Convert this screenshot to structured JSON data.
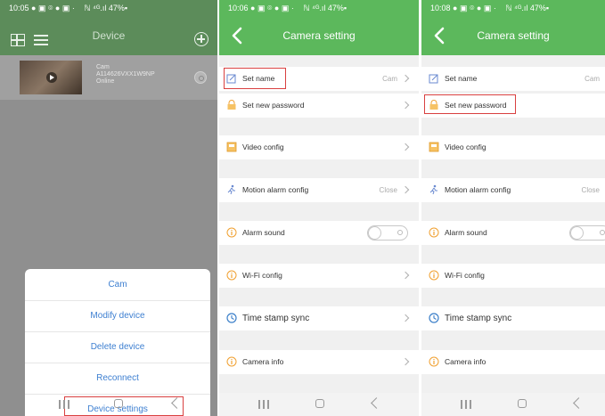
{
  "status_bar": [
    {
      "time": "10:05",
      "indicators": "● ▣ ⌾ ● ▣ ·",
      "right": "ℕ ⁴ᴳ.ıl 47%▪"
    },
    {
      "time": "10:06",
      "indicators": "● ▣ ⌾ ● ▣ ·",
      "right": "ℕ ⁴ᴳ.ıl 47%▪"
    },
    {
      "time": "10:08",
      "indicators": "● ▣ ⌾ ● ▣ ·",
      "right": "ℕ ⁴ᴳ.ıl 47%▪"
    }
  ],
  "device_screen": {
    "title": "Device",
    "device": {
      "name": "Cam",
      "uid": "A114626VXX1W9NP",
      "status": "Online"
    },
    "sheet_items": [
      "Cam",
      "Modify device",
      "Delete device",
      "Reconnect",
      "Device settings"
    ]
  },
  "camera_setting": {
    "title": "Camera setting",
    "rows": [
      {
        "label": "Set name",
        "value": "Cam"
      },
      {
        "label": "Set new password",
        "value": ""
      },
      {
        "label": "Video config",
        "value": ""
      },
      {
        "label": "Motion alarm config",
        "value": "Close"
      },
      {
        "label": "Alarm sound",
        "value": ""
      },
      {
        "label": "Wi-Fi config",
        "value": ""
      },
      {
        "label": "Time stamp sync",
        "value": ""
      },
      {
        "label": "Camera info",
        "value": ""
      }
    ]
  },
  "colors": {
    "accent_green": "#5cb85c",
    "link_blue": "#3d7fd1",
    "highlight_red": "#d94040",
    "icon_orange": "#f0a030"
  },
  "icons": [
    "grid-icon",
    "list-icon",
    "add-icon",
    "settings-icon",
    "back-icon",
    "edit-icon",
    "lock-icon",
    "video-icon",
    "motion-icon",
    "info-icon",
    "clock-icon"
  ]
}
